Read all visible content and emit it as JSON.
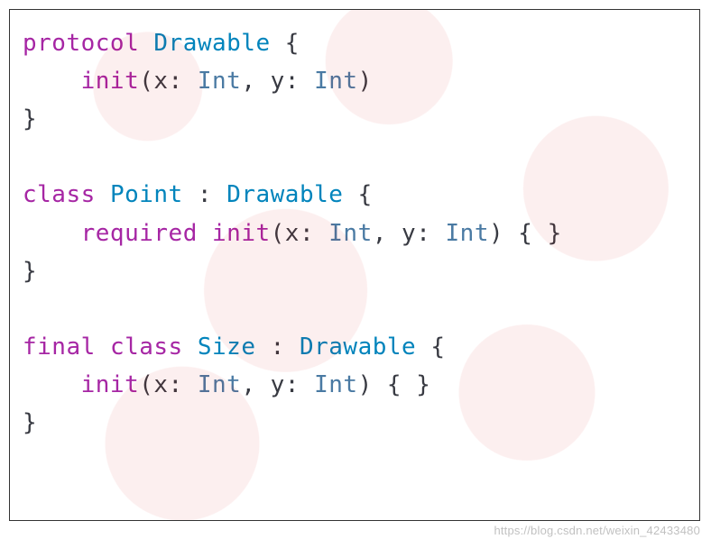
{
  "watermark_url": "https://blog.csdn.net/weixin_42433480",
  "code": {
    "l1_a": "protocol",
    "l1_b": " ",
    "l1_c": "Drawable",
    "l1_d": " {",
    "l2_a": "    ",
    "l2_b": "init",
    "l2_c": "(x: ",
    "l2_d": "Int",
    "l2_e": ", y: ",
    "l2_f": "Int",
    "l2_g": ")",
    "l3_a": "}",
    "blank": "",
    "l4_a": "class",
    "l4_b": " ",
    "l4_c": "Point",
    "l4_d": " : ",
    "l4_e": "Drawable",
    "l4_f": " {",
    "l5_a": "    ",
    "l5_b": "required",
    "l5_c": " ",
    "l5_d": "init",
    "l5_e": "(x: ",
    "l5_f": "Int",
    "l5_g": ", y: ",
    "l5_h": "Int",
    "l5_i": ") { }",
    "l6_a": "}",
    "l7_a": "final",
    "l7_b": " ",
    "l7_c": "class",
    "l7_d": " ",
    "l7_e": "Size",
    "l7_f": " : ",
    "l7_g": "Drawable",
    "l7_h": " {",
    "l8_a": "    ",
    "l8_b": "init",
    "l8_c": "(x: ",
    "l8_d": "Int",
    "l8_e": ", y: ",
    "l8_f": "Int",
    "l8_g": ") { }",
    "l9_a": "}"
  }
}
